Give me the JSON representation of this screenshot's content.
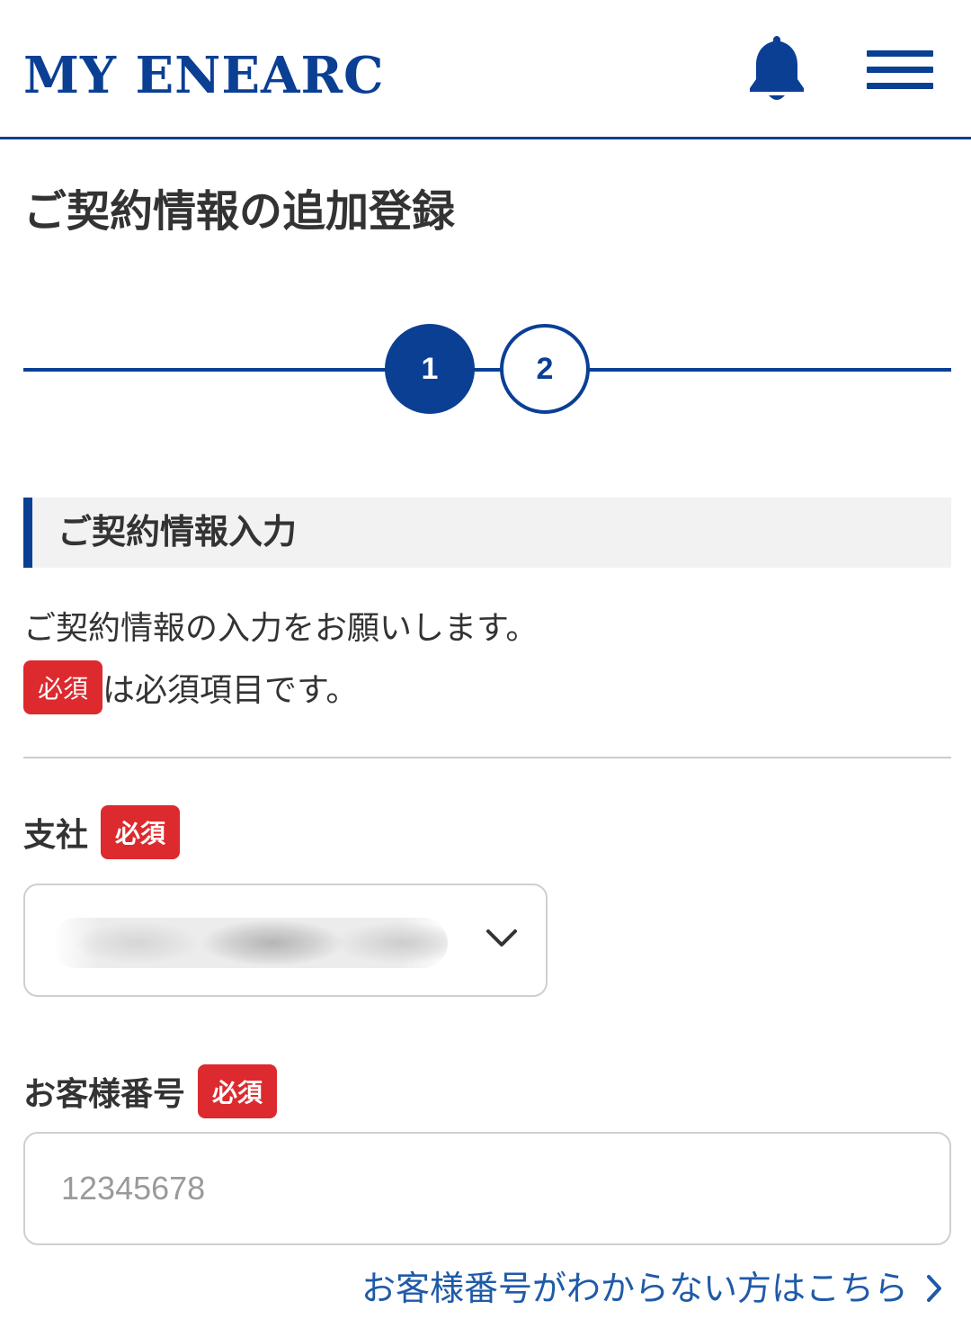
{
  "header": {
    "logo": "MY ENEARC",
    "bell_icon": "bell-icon",
    "menu_icon": "hamburger-menu-icon"
  },
  "page": {
    "title": "ご契約情報の追加登録"
  },
  "stepper": {
    "steps": [
      "1",
      "2"
    ],
    "current": 1
  },
  "section": {
    "title": "ご契約情報入力",
    "intro": "ご契約情報の入力をお願いします。",
    "required_note": "は必須項目です。"
  },
  "badges": {
    "required": "必須"
  },
  "fields": {
    "branch": {
      "label": "支社"
    },
    "customer_number": {
      "label": "お客様番号",
      "placeholder": "12345678",
      "value": ""
    }
  },
  "links": {
    "customer_number_help": "お客様番号がわからない方はこちら"
  },
  "colors": {
    "brand": "#0a3f94",
    "required_badge": "#dc2a2e",
    "link": "#1f5aa8"
  }
}
